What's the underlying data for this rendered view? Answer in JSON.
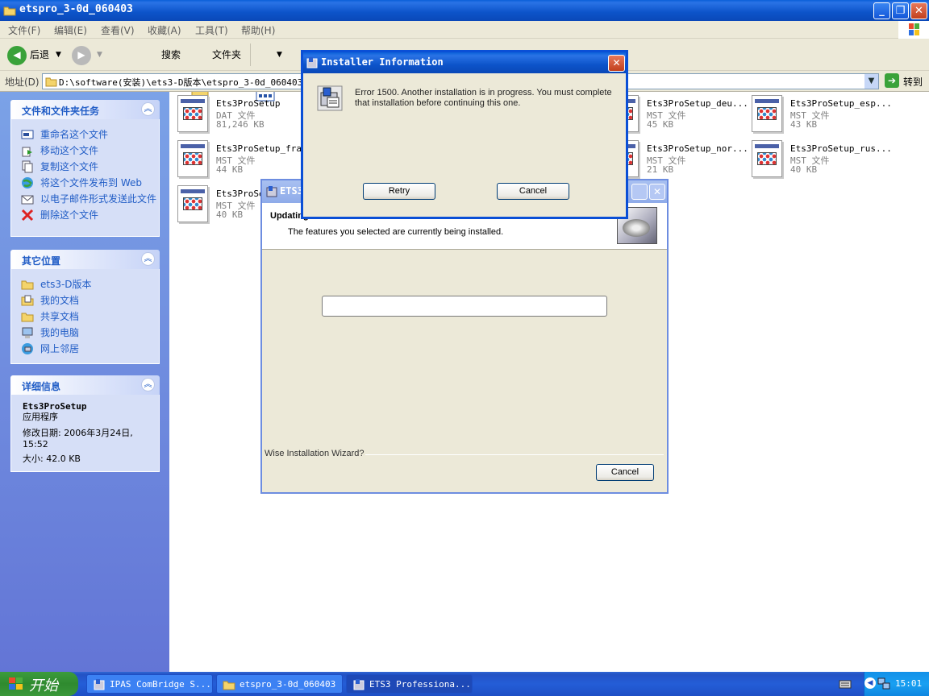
{
  "window": {
    "title": "etspro_3-0d_060403",
    "controls": {
      "minimize": "_",
      "maximize": "❐",
      "close": "✕"
    }
  },
  "menubar": {
    "items": [
      "文件(F)",
      "编辑(E)",
      "查看(V)",
      "收藏(A)",
      "工具(T)",
      "帮助(H)"
    ]
  },
  "toolbar": {
    "back_label": "后退",
    "search_label": "搜索",
    "folders_label": "文件夹"
  },
  "address": {
    "label": "地址(D)",
    "path": "D:\\software(安装)\\ets3-D版本\\etspro_3-0d_060403",
    "go_label": "转到"
  },
  "left_panel": {
    "tasks": {
      "title": "文件和文件夹任务",
      "items": [
        {
          "label": "重命名这个文件",
          "icon": "rename-icon"
        },
        {
          "label": "移动这个文件",
          "icon": "move-icon"
        },
        {
          "label": "复制这个文件",
          "icon": "copy-icon"
        },
        {
          "label": "将这个文件发布到 Web",
          "icon": "publish-web-icon"
        },
        {
          "label": "以电子邮件形式发送此文件",
          "icon": "email-icon"
        },
        {
          "label": "删除这个文件",
          "icon": "delete-icon"
        }
      ]
    },
    "places": {
      "title": "其它位置",
      "items": [
        {
          "label": "ets3-D版本",
          "icon": "folder-icon"
        },
        {
          "label": "我的文档",
          "icon": "my-documents-icon"
        },
        {
          "label": "共享文档",
          "icon": "shared-documents-icon"
        },
        {
          "label": "我的电脑",
          "icon": "my-computer-icon"
        },
        {
          "label": "网上邻居",
          "icon": "network-icon"
        }
      ]
    },
    "details": {
      "title": "详细信息",
      "name": "Ets3ProSetup",
      "type": "应用程序",
      "modified": "修改日期: 2006年3月24日, 15:52",
      "size": "大小: 42.0 KB"
    }
  },
  "files": [
    {
      "name": "Ets3ProSetup",
      "type": "DAT 文件",
      "size": "81,246 KB"
    },
    {
      "name": "Ets3ProSetup_deu...",
      "type": "MST 文件",
      "size": "45 KB"
    },
    {
      "name": "Ets3ProSetup_esp...",
      "type": "MST 文件",
      "size": "43 KB"
    },
    {
      "name": "Ets3ProSetup_fra...",
      "type": "MST 文件",
      "size": "44 KB"
    },
    {
      "name": "Ets3ProSetup_nor...",
      "type": "MST 文件",
      "size": "21 KB"
    },
    {
      "name": "Ets3ProSetup_rus...",
      "type": "MST 文件",
      "size": "40 KB"
    },
    {
      "name": "Ets3ProSe",
      "type": "MST 文件",
      "size": "40 KB"
    }
  ],
  "wizard": {
    "title": "ETS3",
    "heading": "Updating",
    "subheading": "The features you selected are currently being installed.",
    "progress": 0,
    "footer": "Wise Installation Wizard?",
    "cancel_label": "Cancel"
  },
  "info_dialog": {
    "title": "Installer Information",
    "message": "Error 1500. Another installation is in progress. You must complete that installation before continuing this one.",
    "retry_label": "Retry",
    "cancel_label": "Cancel"
  },
  "taskbar": {
    "start_label": "开始",
    "tasks": [
      {
        "label": "IPAS ComBridge S..."
      },
      {
        "label": "etspro_3-0d_060403"
      },
      {
        "label": "ETS3 Professiona..."
      }
    ],
    "clock": "15:01"
  },
  "colors": {
    "xp_blue": "#0a5fd8",
    "panel_link": "#215dc6",
    "start_green": "#2f8a2f"
  }
}
